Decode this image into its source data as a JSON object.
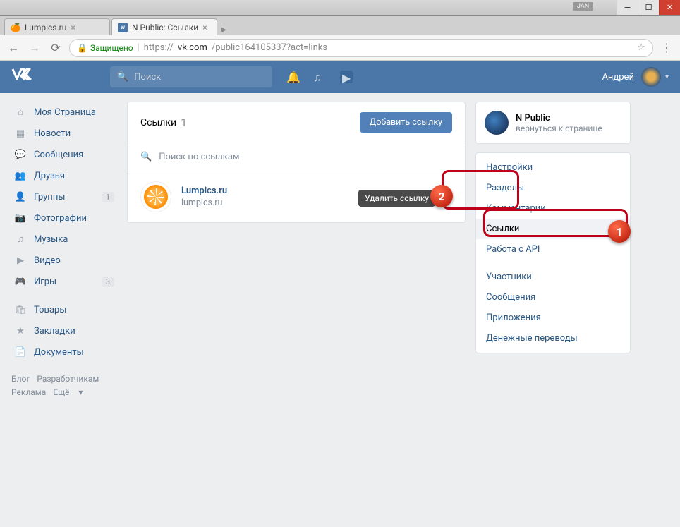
{
  "window": {
    "jan": "JAN"
  },
  "tabs": [
    {
      "title": "Lumpics.ru"
    },
    {
      "title": "N Public: Ссылки"
    }
  ],
  "url": {
    "secure": "Защищено",
    "proto": "https://",
    "host": "vk.com",
    "path": "/public164105337?act=links"
  },
  "header": {
    "search_placeholder": "Поиск",
    "username": "Андрей"
  },
  "nav": {
    "items": [
      {
        "label": "Моя Страница"
      },
      {
        "label": "Новости"
      },
      {
        "label": "Сообщения"
      },
      {
        "label": "Друзья"
      },
      {
        "label": "Группы",
        "badge": "1"
      },
      {
        "label": "Фотографии"
      },
      {
        "label": "Музыка"
      },
      {
        "label": "Видео"
      },
      {
        "label": "Игры",
        "badge": "3"
      }
    ],
    "items2": [
      {
        "label": "Товары"
      },
      {
        "label": "Закладки"
      },
      {
        "label": "Документы"
      }
    ],
    "footer": {
      "blog": "Блог",
      "dev": "Разработчикам",
      "ads": "Реклама",
      "more": "Ещё"
    }
  },
  "main": {
    "title": "Ссылки",
    "count": "1",
    "add_button": "Добавить ссылку",
    "search_placeholder": "Поиск по ссылкам",
    "link": {
      "title": "Lumpics.ru",
      "subtitle": "lumpics.ru"
    },
    "tooltip": "Удалить ссылку"
  },
  "right": {
    "group_name": "N Public",
    "back": "вернуться к странице",
    "settings": [
      "Настройки",
      "Разделы",
      "Комментарии",
      "Ссылки",
      "Работа с API",
      "Участники",
      "Сообщения",
      "Приложения",
      "Денежные переводы"
    ]
  },
  "annotations": {
    "b1": "1",
    "b2": "2"
  }
}
